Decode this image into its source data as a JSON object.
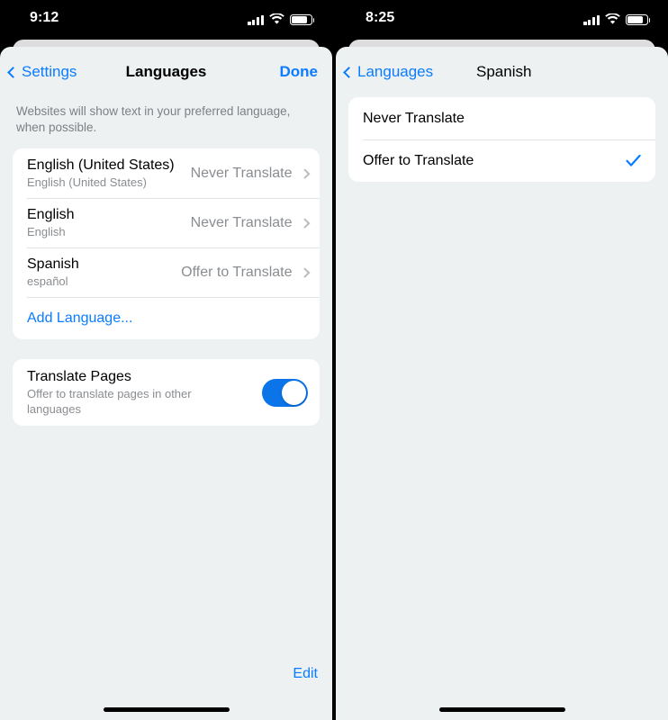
{
  "left_screen": {
    "status_bar": {
      "time": "9:12",
      "signal_icon": "cellular-signal-icon",
      "wifi_icon": "wifi-icon",
      "battery_icon": "battery-icon"
    },
    "nav": {
      "back_label": "Settings",
      "back_icon": "chevron-left-icon",
      "title": "Languages",
      "action_label": "Done"
    },
    "footnote": "Websites will show text in your preferred language, when possible.",
    "languages": [
      {
        "title": "English (United States)",
        "subtitle": "English (United States)",
        "value": "Never Translate",
        "chevron_icon": "chevron-right-icon"
      },
      {
        "title": "English",
        "subtitle": "English",
        "value": "Never Translate",
        "chevron_icon": "chevron-right-icon"
      },
      {
        "title": "Spanish",
        "subtitle": "español",
        "value": "Offer to Translate",
        "chevron_icon": "chevron-right-icon"
      }
    ],
    "add_language_label": "Add Language...",
    "translate_pages": {
      "title": "Translate Pages",
      "subtitle": "Offer to translate pages in other languages",
      "toggle_state": "on",
      "toggle_color": "#0a74e8"
    },
    "edit_label": "Edit",
    "home_indicator": "home-indicator"
  },
  "right_screen": {
    "status_bar": {
      "time": "8:25",
      "signal_icon": "cellular-signal-icon",
      "wifi_icon": "wifi-icon",
      "battery_icon": "battery-icon"
    },
    "nav": {
      "back_label": "Languages",
      "back_icon": "chevron-left-icon",
      "title": "Spanish"
    },
    "options": [
      {
        "label": "Never Translate",
        "selected": false
      },
      {
        "label": "Offer to Translate",
        "selected": true
      }
    ],
    "checkmark_icon": "checkmark-icon",
    "checkmark_color": "#0a7cff",
    "home_indicator": "home-indicator"
  },
  "theme": {
    "accent": "#0a7cff",
    "sheet_bg": "#eef1f2",
    "card_bg": "#ffffff",
    "back_sheet_bg": "#dddddd",
    "secondary_text": "#8a8d91",
    "screen_bg": "#000000"
  }
}
